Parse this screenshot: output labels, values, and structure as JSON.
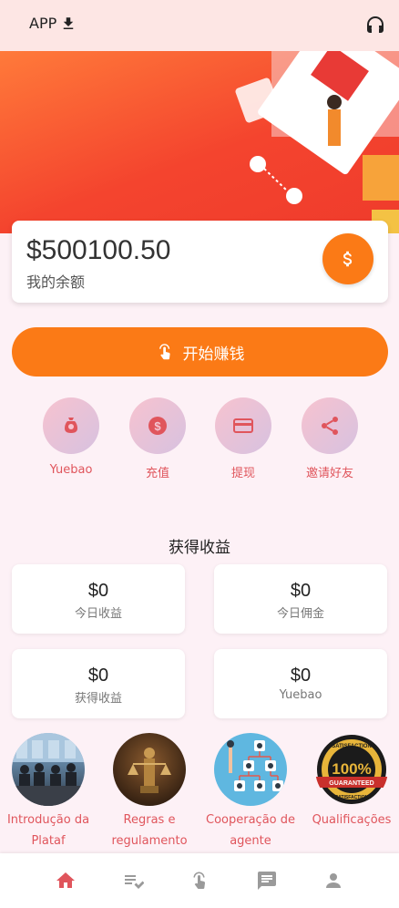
{
  "header": {
    "app_label": "APP",
    "download_icon": "download-icon",
    "support_icon": "headset-icon"
  },
  "balance": {
    "amount": "$500100.50",
    "label": "我的余额",
    "coin_icon": "dollar-icon"
  },
  "start_button": {
    "label": "开始赚钱",
    "icon": "touch-icon"
  },
  "quick_actions": [
    {
      "label": "Yuebao",
      "icon": "moneybag-icon"
    },
    {
      "label": "充值",
      "icon": "dollar-coin-icon"
    },
    {
      "label": "提现",
      "icon": "card-icon"
    },
    {
      "label": "邀请好友",
      "icon": "share-icon"
    }
  ],
  "earnings": {
    "title": "获得收益",
    "stats": [
      {
        "value": "$0",
        "label": "今日收益"
      },
      {
        "value": "$0",
        "label": "今日佣金"
      },
      {
        "value": "$0",
        "label": "获得收益"
      },
      {
        "value": "$0",
        "label": "Yuebao"
      }
    ]
  },
  "info_links": [
    {
      "label": "Introdução da Plataf",
      "icon": "meeting-photo"
    },
    {
      "label": "Regras e regulamento",
      "icon": "justice-statue-photo"
    },
    {
      "label": "Cooperação de agente",
      "icon": "network-icon"
    },
    {
      "label": "Qualificações",
      "icon": "guarantee-badge"
    }
  ],
  "info_badge": {
    "top": "SATISFACTION",
    "middle": "100%",
    "ribbon": "GUARANTEED",
    "bottom": "SATISFACTION"
  },
  "bottom_nav": [
    {
      "icon": "home-icon",
      "active": true
    },
    {
      "icon": "task-list-icon",
      "active": false
    },
    {
      "icon": "touch-icon",
      "active": false
    },
    {
      "icon": "chat-icon",
      "active": false
    },
    {
      "icon": "user-icon",
      "active": false
    }
  ],
  "colors": {
    "accent": "#fb7a16",
    "label_red": "#e0555c",
    "active_nav": "#e0555c",
    "inactive_nav": "#9a9a9a"
  }
}
